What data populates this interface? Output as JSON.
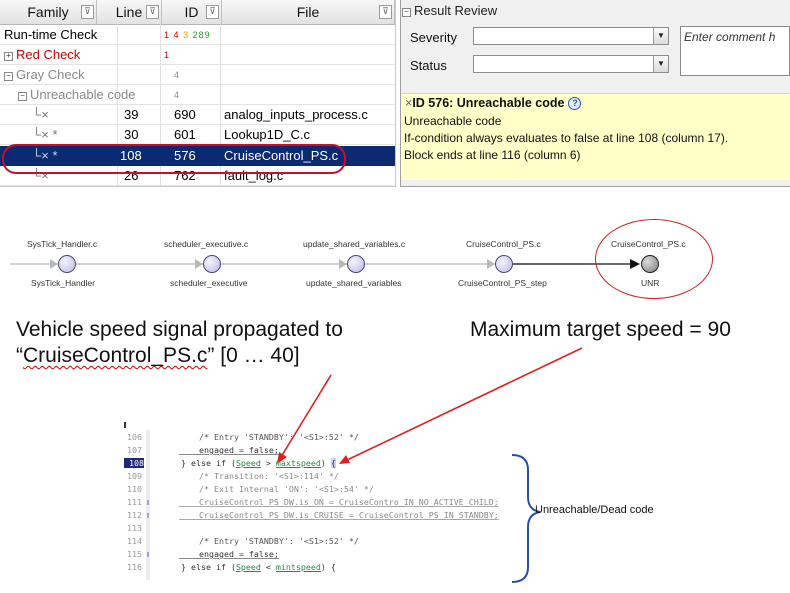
{
  "results_table": {
    "columns": [
      "Family",
      "Line",
      "ID",
      "File"
    ],
    "filter_icon": "filter-icon",
    "rows": [
      {
        "family": "Run-time Check",
        "line": "",
        "id": "",
        "counts": [
          "1",
          "4",
          "3",
          "289"
        ],
        "file": ""
      },
      {
        "family": "Red Check",
        "line": "",
        "id": "",
        "count": "1",
        "file": ""
      },
      {
        "family": "Gray Check",
        "line": "",
        "id": "",
        "count": "4",
        "file": ""
      },
      {
        "family": "Unreachable code",
        "line": "",
        "id": "",
        "count": "4",
        "file": ""
      },
      {
        "family": "",
        "line": "39",
        "id": "690",
        "file": "analog_inputs_process.c"
      },
      {
        "family": "*",
        "line": "30",
        "id": "601",
        "file": "Lookup1D_C.c"
      },
      {
        "family": "*",
        "line": "108",
        "id": "576",
        "file": "CruiseControl_PS.c",
        "selected": true
      },
      {
        "family": "",
        "line": "26",
        "id": "762",
        "file": "fault_log.c"
      }
    ],
    "tree_collapse": "⊟",
    "tree_expand": "⊞",
    "status_mark": "×",
    "count_colors": [
      "#d10000",
      "#d10000",
      "#e0a000",
      "#2c9a2c"
    ]
  },
  "result_review": {
    "title": "Result Review",
    "severity_label": "Severity",
    "severity_value": "",
    "status_label": "Status",
    "status_value": "",
    "comment_placeholder": "Enter comment h",
    "detail": {
      "heading": "ID 576: Unreachable code",
      "lines": [
        "Unreachable code",
        "If-condition always evaluates to false at line 108 (column 17).",
        "Block ends at line 116 (column 6)"
      ]
    }
  },
  "call_graph": {
    "nodes": [
      {
        "file": "SysTick_Handler.c",
        "function": "SysTick_Handler"
      },
      {
        "file": "scheduler_executive.c",
        "function": "scheduler_executive"
      },
      {
        "file": "update_shared_variables.c",
        "function": "update_shared_variables"
      },
      {
        "file": "CruiseControl_PS.c",
        "function": "CruiseControl_PS_step"
      },
      {
        "file": "CruiseControl_PS.c",
        "function": "UNR"
      }
    ]
  },
  "annotations": {
    "left_line1": "Vehicle speed signal propagated to",
    "left_line2_prefix": "“",
    "left_line2_file": "CruiseControl_PS.c",
    "left_line2_suffix": "” [0 … 40]",
    "right": "Maximum target speed = 90",
    "brace_label": "Unreachable/Dead code",
    "arrow_color": "#e02020"
  },
  "code": {
    "lines": [
      {
        "num": "106",
        "text": "    /* Entry 'STANDBY': '<S1>:52' */"
      },
      {
        "num": "107",
        "text": "    engaged = false;"
      },
      {
        "num": "108",
        "text": "  } else if (Speed > maxtspeed) {",
        "current": true
      },
      {
        "num": "109",
        "text": "    /* Transition: '<S1>:114' */"
      },
      {
        "num": "110",
        "text": "    /* Exit Internal 'ON': '<S1>:54' */"
      },
      {
        "num": "111",
        "text": "    CruiseControl_PS_DW.is_ON = CruiseContro_IN_NO_ACTIVE_CHILD;"
      },
      {
        "num": "112",
        "text": "    CruiseControl_PS_DW.is_CRUISE = CruiseControl_PS_IN_STANDBY;"
      },
      {
        "num": "113",
        "text": ""
      },
      {
        "num": "114",
        "text": "    /* Entry 'STANDBY': '<S1>:52' */"
      },
      {
        "num": "115",
        "text": "    engaged = false;"
      },
      {
        "num": "116",
        "text": "  } else if (Speed < mintspeed) {"
      }
    ]
  }
}
